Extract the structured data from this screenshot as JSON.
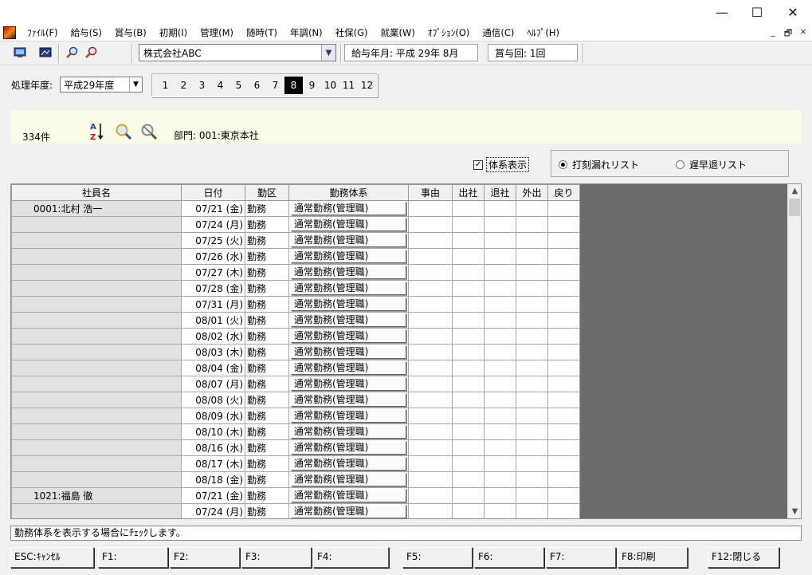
{
  "window": {
    "minimize_glyph": "—",
    "maximize_glyph": "☐",
    "close_glyph": "✕"
  },
  "menu": [
    "ﾌｧｲﾙ(F)",
    "給与(S)",
    "賞与(B)",
    "初期(I)",
    "管理(M)",
    "随時(T)",
    "年調(N)",
    "社保(G)",
    "就業(W)",
    "ｵﾌﾟｼｮﾝ(O)",
    "通信(C)",
    "ﾍﾙﾌﾟ(H)"
  ],
  "mdi_controls": [
    "_",
    "🗗",
    "×"
  ],
  "toolbar": {
    "company": "株式会社ABC",
    "pay_month": "給与年月: 平成 29年  8月",
    "bonus_count": "賞与回: 1回"
  },
  "year": {
    "label": "処理年度:",
    "value": "平成29年度"
  },
  "months": [
    "1",
    "2",
    "3",
    "4",
    "5",
    "6",
    "7",
    "8",
    "9",
    "10",
    "11",
    "12"
  ],
  "active_month": "8",
  "info": {
    "count": "334件",
    "dept": "部門:  001:東京本社"
  },
  "options": {
    "show_system_label": "体系表示",
    "show_system_checked": true,
    "radio_missing_label": "打刻漏れリスト",
    "radio_late_label": "遅早退リスト"
  },
  "grid": {
    "headers": [
      "社員名",
      "日付",
      "勤区",
      "勤務体系",
      "事由",
      "出社",
      "退社",
      "外出",
      "戻り"
    ],
    "rows": [
      {
        "emp": "0001:北村  浩一",
        "date": "07/21 (金)",
        "kubun": "勤務",
        "system": "通常勤務(管理職)"
      },
      {
        "emp": "",
        "date": "07/24 (月)",
        "kubun": "勤務",
        "system": "通常勤務(管理職)"
      },
      {
        "emp": "",
        "date": "07/25 (火)",
        "kubun": "勤務",
        "system": "通常勤務(管理職)"
      },
      {
        "emp": "",
        "date": "07/26 (水)",
        "kubun": "勤務",
        "system": "通常勤務(管理職)"
      },
      {
        "emp": "",
        "date": "07/27 (木)",
        "kubun": "勤務",
        "system": "通常勤務(管理職)"
      },
      {
        "emp": "",
        "date": "07/28 (金)",
        "kubun": "勤務",
        "system": "通常勤務(管理職)"
      },
      {
        "emp": "",
        "date": "07/31 (月)",
        "kubun": "勤務",
        "system": "通常勤務(管理職)"
      },
      {
        "emp": "",
        "date": "08/01 (火)",
        "kubun": "勤務",
        "system": "通常勤務(管理職)"
      },
      {
        "emp": "",
        "date": "08/02 (水)",
        "kubun": "勤務",
        "system": "通常勤務(管理職)"
      },
      {
        "emp": "",
        "date": "08/03 (木)",
        "kubun": "勤務",
        "system": "通常勤務(管理職)"
      },
      {
        "emp": "",
        "date": "08/04 (金)",
        "kubun": "勤務",
        "system": "通常勤務(管理職)"
      },
      {
        "emp": "",
        "date": "08/07 (月)",
        "kubun": "勤務",
        "system": "通常勤務(管理職)"
      },
      {
        "emp": "",
        "date": "08/08 (火)",
        "kubun": "勤務",
        "system": "通常勤務(管理職)"
      },
      {
        "emp": "",
        "date": "08/09 (水)",
        "kubun": "勤務",
        "system": "通常勤務(管理職)"
      },
      {
        "emp": "",
        "date": "08/10 (木)",
        "kubun": "勤務",
        "system": "通常勤務(管理職)"
      },
      {
        "emp": "",
        "date": "08/16 (水)",
        "kubun": "勤務",
        "system": "通常勤務(管理職)"
      },
      {
        "emp": "",
        "date": "08/17 (木)",
        "kubun": "勤務",
        "system": "通常勤務(管理職)"
      },
      {
        "emp": "",
        "date": "08/18 (金)",
        "kubun": "勤務",
        "system": "通常勤務(管理職)"
      },
      {
        "emp": "1021:福島  徹",
        "date": "07/21 (金)",
        "kubun": "勤務",
        "system": "通常勤務(管理職)"
      },
      {
        "emp": "",
        "date": "07/24 (月)",
        "kubun": "勤務",
        "system": "通常勤務(管理職)"
      }
    ]
  },
  "status": "勤務体系を表示する場合にﾁｪｯｸします。",
  "fkeys": [
    "ESC:ｷｬﾝｾﾙ",
    "F1:",
    "F2:",
    "F3:",
    "F4:",
    "F5:",
    "F6:",
    "F7:",
    "F8:印刷",
    "F12:閉じる"
  ],
  "colors": {
    "grid_background": "#6b6b6b",
    "info_panel": "#fbfbe9",
    "active_month_bg": "#000000"
  }
}
